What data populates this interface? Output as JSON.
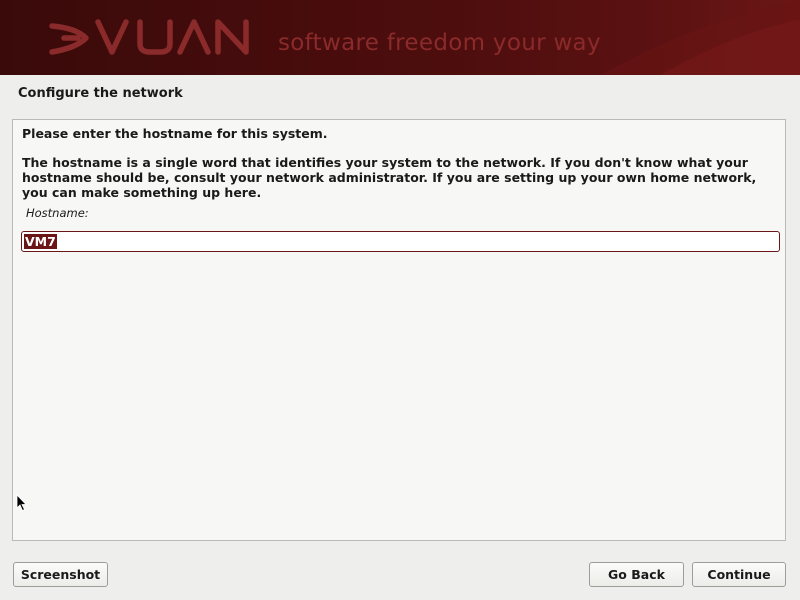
{
  "banner": {
    "logo_text": "DEVUAN",
    "tagline": "software freedom your way",
    "colors": {
      "background": "#4d0d0d",
      "tagline": "#8a2a2a",
      "accent": "#6b1616"
    }
  },
  "page": {
    "title": "Configure the network"
  },
  "content": {
    "prompt": "Please enter the hostname for this system.",
    "description": "The hostname is a single word that identifies your system to the network. If you don't know what your hostname should be, consult your network administrator. If you are setting up your own home network, you can make something up here.",
    "field_label": "Hostname:",
    "hostname_value": "VM7"
  },
  "buttons": {
    "screenshot": "Screenshot",
    "back": "Go Back",
    "continue": "Continue"
  },
  "icons": {
    "cursor": "mouse-pointer-icon",
    "logo": "devuan-logo-icon"
  }
}
